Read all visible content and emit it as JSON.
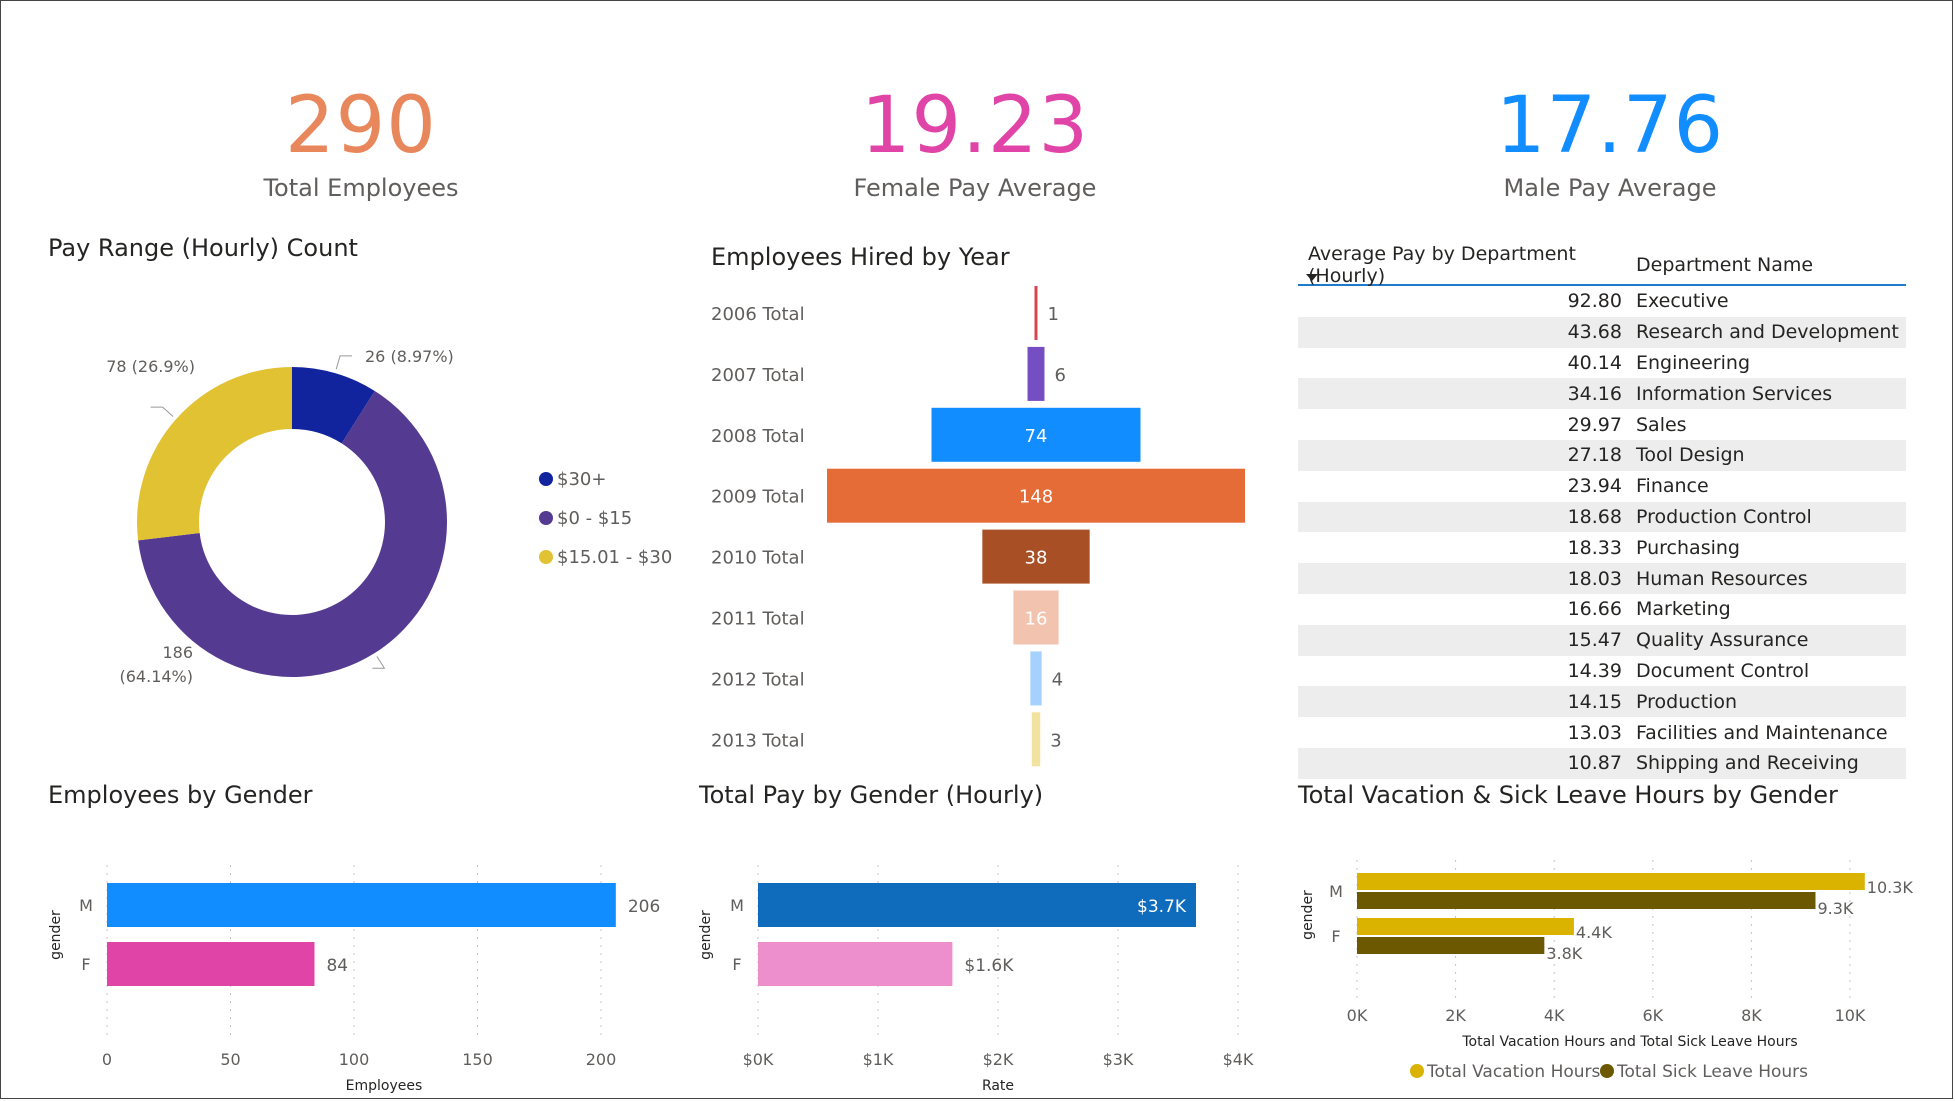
{
  "kpis": {
    "total": {
      "value": "290",
      "label": "Total Employees",
      "color": "#E8875B"
    },
    "female": {
      "value": "19.23",
      "label": "Female Pay Average",
      "color": "#E044A7"
    },
    "male": {
      "value": "17.76",
      "label": "Male Pay Average",
      "color": "#118DFF"
    }
  },
  "titles": {
    "donut": "Pay Range (Hourly) Count",
    "funnel": "Employees Hired by Year",
    "gender": "Employees by Gender",
    "pay": "Total Pay by Gender (Hourly)",
    "leave": "Total Vacation & Sick Leave Hours by Gender"
  },
  "table": {
    "headers": [
      "Average Pay by Department (Hourly)",
      "Department Name"
    ],
    "rows": [
      [
        "92.80",
        "Executive"
      ],
      [
        "43.68",
        "Research and Development"
      ],
      [
        "40.14",
        "Engineering"
      ],
      [
        "34.16",
        "Information Services"
      ],
      [
        "29.97",
        "Sales"
      ],
      [
        "27.18",
        "Tool Design"
      ],
      [
        "23.94",
        "Finance"
      ],
      [
        "18.68",
        "Production Control"
      ],
      [
        "18.33",
        "Purchasing"
      ],
      [
        "18.03",
        "Human Resources"
      ],
      [
        "16.66",
        "Marketing"
      ],
      [
        "15.47",
        "Quality Assurance"
      ],
      [
        "14.39",
        "Document Control"
      ],
      [
        "14.15",
        "Production"
      ],
      [
        "13.03",
        "Facilities and Maintenance"
      ],
      [
        "10.87",
        "Shipping and Receiving"
      ]
    ]
  },
  "chart_data": [
    {
      "type": "pie",
      "title": "Pay Range (Hourly) Count",
      "hole": true,
      "slices": [
        {
          "name": "$30+",
          "value": 26,
          "label": "26 (8.97%)",
          "color": "#12239E"
        },
        {
          "name": "$0 - $15",
          "value": 186,
          "label": "186 (64.14%)",
          "color": "#553A91"
        },
        {
          "name": "$15.01 - $30",
          "value": 78,
          "label": "78 (26.9%)",
          "color": "#E1C233"
        }
      ],
      "legend": "right"
    },
    {
      "type": "bar",
      "subtype": "funnel",
      "title": "Employees Hired by Year",
      "categories": [
        "2006 Total",
        "2007 Total",
        "2008 Total",
        "2009 Total",
        "2010 Total",
        "2011 Total",
        "2012 Total",
        "2013 Total"
      ],
      "values": [
        1,
        6,
        74,
        148,
        38,
        16,
        4,
        3
      ],
      "colors": [
        "#D64550",
        "#744EC2",
        "#118DFF",
        "#E66C37",
        "#A94F26",
        "#F2C3AE",
        "#A5D1FF",
        "#F2E2A0"
      ]
    },
    {
      "type": "bar",
      "orientation": "horizontal",
      "title": "Employees by Gender",
      "categories": [
        "M",
        "F"
      ],
      "values": [
        206,
        84
      ],
      "colors": [
        "#118DFF",
        "#E044A7"
      ],
      "xlabel": "Employees",
      "ylabel": "gender",
      "xticks": [
        "0",
        "50",
        "100",
        "150",
        "200"
      ],
      "xlim": [
        0,
        220
      ],
      "grid": true
    },
    {
      "type": "bar",
      "orientation": "horizontal",
      "title": "Total Pay by Gender (Hourly)",
      "categories": [
        "M",
        "F"
      ],
      "values": [
        3650,
        1620
      ],
      "value_labels": [
        "$3.7K",
        "$1.6K"
      ],
      "colors": [
        "#0F6CBD",
        "#EE8FCD"
      ],
      "xlabel": "Rate",
      "ylabel": "gender",
      "xticks": [
        "$0K",
        "$1K",
        "$2K",
        "$3K",
        "$4K"
      ],
      "xlim": [
        0,
        4000
      ],
      "grid": true
    },
    {
      "type": "bar",
      "orientation": "horizontal",
      "title": "Total Vacation & Sick Leave Hours by Gender",
      "categories": [
        "M",
        "F"
      ],
      "series": [
        {
          "name": "Total Vacation Hours",
          "values": [
            10300,
            4400
          ],
          "labels": [
            "10.3K",
            "4.4K"
          ],
          "color": "#D9B300"
        },
        {
          "name": "Total Sick Leave Hours",
          "values": [
            9300,
            3800
          ],
          "labels": [
            "9.3K",
            "3.8K"
          ],
          "color": "#6B5800"
        }
      ],
      "xlabel": "Total Vacation Hours and Total Sick Leave Hours",
      "ylabel": "gender",
      "xticks": [
        "0K",
        "2K",
        "4K",
        "6K",
        "8K",
        "10K"
      ],
      "xlim": [
        0,
        10000
      ],
      "legend": "bottom",
      "grid": true
    }
  ]
}
